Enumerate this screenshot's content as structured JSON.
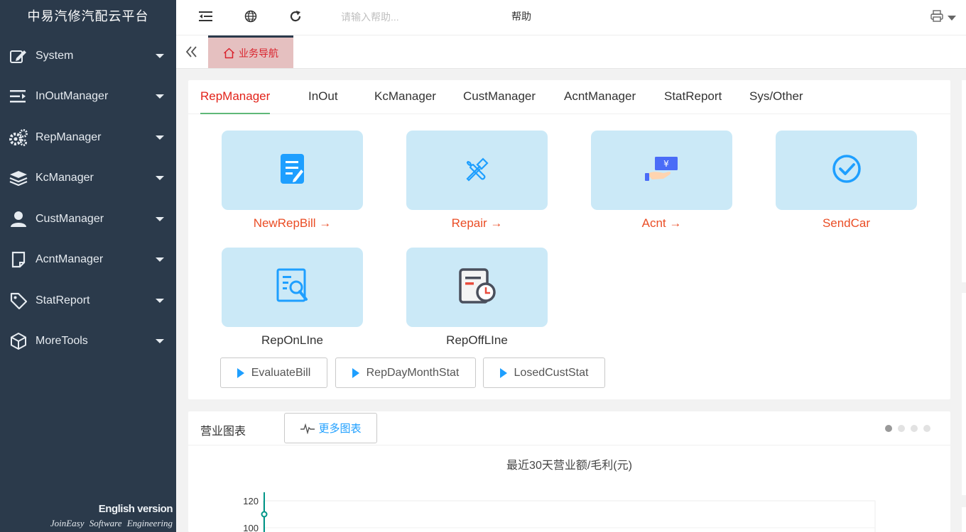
{
  "app": {
    "title": "中易汽修汽配云平台"
  },
  "sidebar": {
    "items": [
      {
        "label": "System",
        "icon": "edit-icon"
      },
      {
        "label": "InOutManager",
        "icon": "indent-icon"
      },
      {
        "label": "RepManager",
        "icon": "gears-icon"
      },
      {
        "label": "KcManager",
        "icon": "layers-icon"
      },
      {
        "label": "CustManager",
        "icon": "user-icon"
      },
      {
        "label": "AcntManager",
        "icon": "note-icon"
      },
      {
        "label": "StatReport",
        "icon": "tag-icon"
      },
      {
        "label": "MoreTools",
        "icon": "cube-icon"
      }
    ],
    "footer": {
      "english": "English version",
      "company": "JoinEasy Software Engineering"
    }
  },
  "topbar": {
    "search_placeholder": "请输入帮助...",
    "help_label": "帮助"
  },
  "tabstrip": {
    "home_tab": "业务导航"
  },
  "categories": [
    "RepManager",
    "InOut",
    "KcManager",
    "CustManager",
    "AcntManager",
    "StatReport",
    "Sys/Other"
  ],
  "active_category": "RepManager",
  "tiles": [
    {
      "label": "NewRepBill →",
      "icon": "document-edit-icon"
    },
    {
      "label": "Repair →",
      "icon": "tools-icon"
    },
    {
      "label": "Acnt →",
      "icon": "payment-icon"
    },
    {
      "label": "SendCar",
      "icon": "check-circle-icon"
    },
    {
      "label": "RepOnLIne",
      "icon": "report-search-icon"
    },
    {
      "label": "RepOffLIne",
      "icon": "report-clock-icon"
    }
  ],
  "mini_buttons": [
    "EvaluateBill",
    "RepDayMonthStat",
    "LosedCustStat"
  ],
  "chart_panel": {
    "title": "营业图表",
    "more_label": "更多图表",
    "carousel": {
      "count": 4,
      "active": 1
    }
  },
  "chart_data": {
    "type": "line",
    "title": "最近30天营业额/毛利(元)",
    "y_ticks": [
      120,
      100
    ],
    "first_point_y": 110
  },
  "colors": {
    "sidebar": "#2b3a4b",
    "accent": "#1e9fff",
    "active_red": "#e2231a",
    "tile_bg": "#cbe9f7"
  }
}
